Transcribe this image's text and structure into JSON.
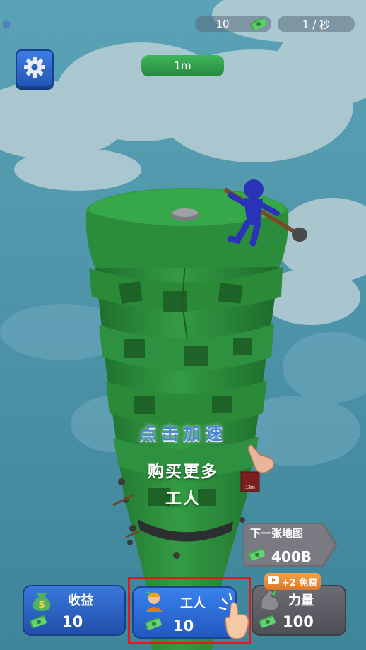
{
  "hud": {
    "cash_value": "10",
    "rate": "1 / 秒",
    "height": "1m"
  },
  "center": {
    "tap_speed": "点击加速",
    "buy_line1": "购买更多",
    "buy_line2": "工人"
  },
  "next_map": {
    "label": "下一张地图",
    "price": "400B"
  },
  "buttons": {
    "income": {
      "label": "收益",
      "value": "10"
    },
    "worker": {
      "label": "工人",
      "value": "10"
    },
    "power": {
      "label": "力量",
      "value": "100"
    },
    "free_badge": "+2 免费"
  },
  "sign_text": "13m",
  "colors": {
    "sky": "#4b92a6",
    "tower_green": "#2f8f3e",
    "worker_blue": "#2a33b8",
    "button_blue": "#2f6fd8",
    "button_gray": "#5e5e66",
    "highlight_red": "#e01919"
  }
}
